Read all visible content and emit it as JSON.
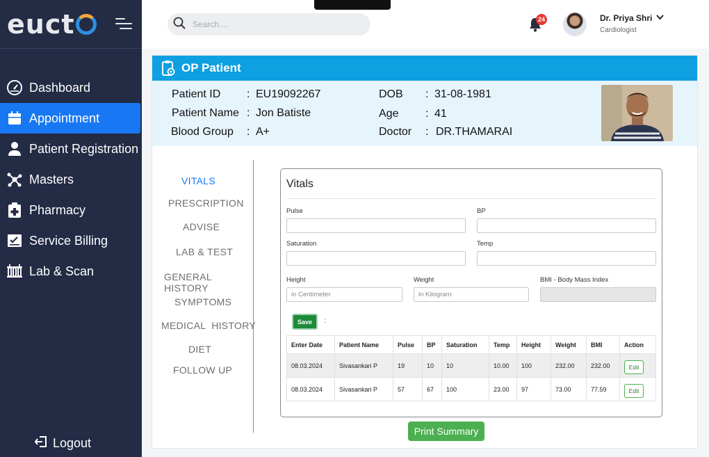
{
  "brand": {
    "logo_text": "euct"
  },
  "sidebar": {
    "items": [
      {
        "label": "Dashboard",
        "icon": "dashboard-gauge-icon"
      },
      {
        "label": "Appointment",
        "icon": "calendar-icon",
        "active": true
      },
      {
        "label": "Patient Registration",
        "icon": "user-icon"
      },
      {
        "label": "Masters",
        "icon": "network-icon"
      },
      {
        "label": "Pharmacy",
        "icon": "medical-kit-icon"
      },
      {
        "label": "Service Billing",
        "icon": "billing-check-icon"
      },
      {
        "label": "Lab & Scan",
        "icon": "lab-icon"
      }
    ],
    "logout_label": "Logout"
  },
  "topbar": {
    "search_placeholder": "Search....",
    "notification_count": "24",
    "user_name": "Dr. Priya Shri",
    "user_role": "Cardiologist"
  },
  "op": {
    "header_title": "OP Patient",
    "patient": {
      "id_label": "Patient ID",
      "id": "EU19092267",
      "name_label": "Patient Name",
      "name": "Jon Batiste",
      "blood_label": "Blood Group",
      "blood": "A+",
      "dob_label": "DOB",
      "dob": "31-08-1981",
      "age_label": "Age",
      "age": "41",
      "doctor_label": "Doctor",
      "doctor": "DR.THAMARAI",
      "colon": ":"
    },
    "tabs": [
      "VITALS",
      "PRESCRIPTION",
      "ADVISE",
      "LAB & TEST",
      "GENERAL HISTORY",
      "SYMPTOMS",
      "MEDICAL  HISTORY",
      "DIET",
      "FOLLOW UP"
    ],
    "active_tab": "VITALS"
  },
  "vitals": {
    "title": "Vitals",
    "fields": {
      "pulse_label": "Pulse",
      "bp_label": "BP",
      "saturation_label": "Saturation",
      "temp_label": "Temp",
      "height_label": "Height",
      "height_placeholder": "in Centimeter",
      "weight_label": "Weight",
      "weight_placeholder": "in Kilogram",
      "bmi_label": "BMI - Body Mass Index"
    },
    "save_label": "Save",
    "colon": ":",
    "table": {
      "headers": [
        "Enter Date",
        "Patient Name",
        "Pulse",
        "BP",
        "Saturation",
        "Temp",
        "Height",
        "Weight",
        "BMI",
        "Action"
      ],
      "rows": [
        [
          "08.03.2024",
          "Sivasankari P",
          "19",
          "10",
          "10",
          "10.00",
          "100",
          "232.00",
          "232.00",
          "Edit"
        ],
        [
          "08.03.2024",
          "Sivasankari P",
          "57",
          "67",
          "100",
          "23.00",
          "97",
          "73.00",
          "77.59",
          "Edit"
        ]
      ]
    }
  },
  "print_label": "Print Summary",
  "colors": {
    "sidebar_bg": "#232b45",
    "accent": "#1877f2",
    "header_bg": "#0ea0e0",
    "panel_bg": "#e6f4fc",
    "success": "#4caf50"
  }
}
